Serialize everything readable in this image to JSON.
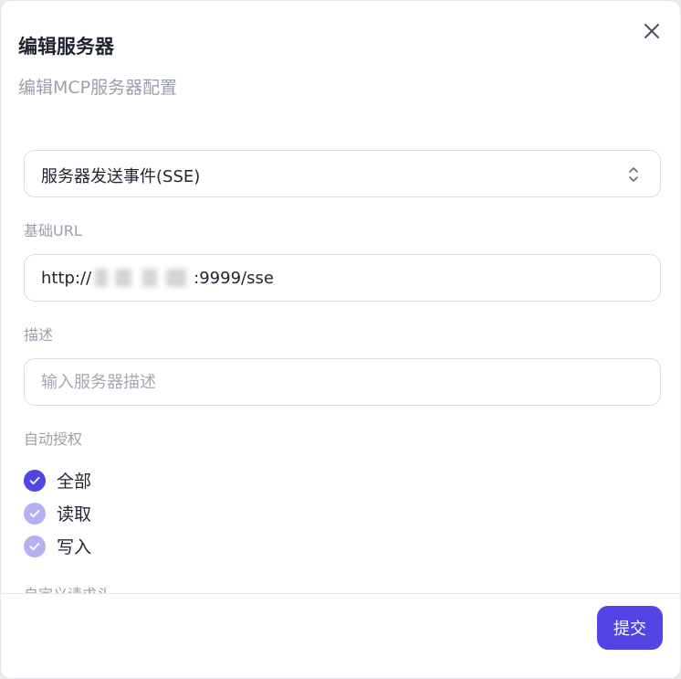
{
  "dialog": {
    "title": "编辑服务器",
    "subtitle": "编辑MCP服务器配置",
    "close_icon": "close-icon"
  },
  "form": {
    "transport": {
      "selected": "服务器发送事件(SSE)",
      "icon": "chevron-up-down-icon"
    },
    "base_url": {
      "label": "基础URL",
      "value_prefix": "http://",
      "value_suffix": ":9999/sse"
    },
    "description": {
      "label": "描述",
      "value": "",
      "placeholder": "输入服务器描述"
    },
    "auto_auth": {
      "label": "自动授权",
      "options": [
        {
          "label": "全部",
          "checked": true
        },
        {
          "label": "读取",
          "checked": true
        },
        {
          "label": "写入",
          "checked": true
        }
      ]
    },
    "custom_headers": {
      "label": "自定义请求头"
    }
  },
  "footer": {
    "submit_label": "提交"
  },
  "colors": {
    "accent": "#5146e5",
    "accent_dim": "#b5b0f2",
    "muted_text": "#9aa0ab"
  }
}
